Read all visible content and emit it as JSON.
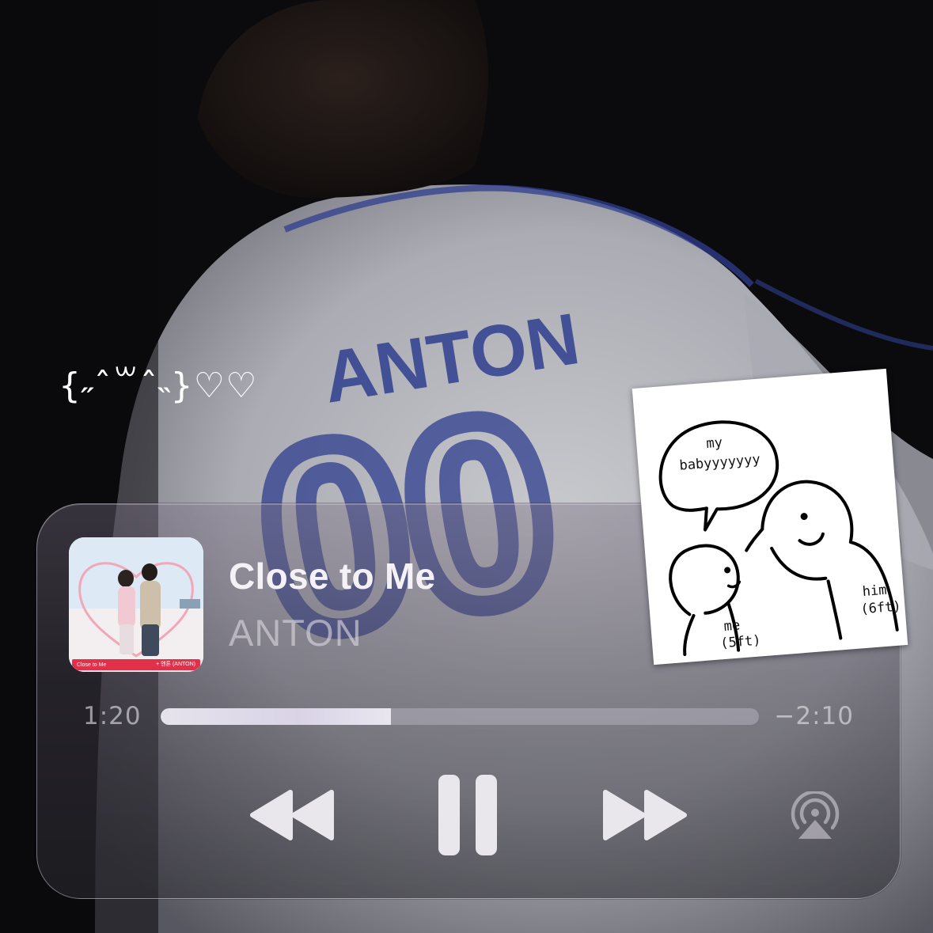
{
  "decoration": {
    "kaomoji": "{˶ˆ꒳ˆ˵}♡♡"
  },
  "background": {
    "jersey_name": "ANTON",
    "jersey_number": "00"
  },
  "now_playing": {
    "album_art": {
      "song_label": "Close to Me",
      "artist_label": "+ 앤톤 (ANTON)"
    },
    "track_title": "Close to Me",
    "artist": "ANTON",
    "elapsed": "1:20",
    "remaining": "−2:10",
    "progress_fraction": 0.385,
    "controls": {
      "rewind_icon": "rewind-icon",
      "pause_icon": "pause-icon",
      "forward_icon": "fast-forward-icon",
      "airplay_icon": "airplay-icon"
    }
  },
  "sticker": {
    "bubble_line1": "my",
    "bubble_line2": "babyyyyyyy",
    "label_me": "me",
    "label_me_height": "(5ft)",
    "label_him": "him",
    "label_him_height": "(6ft)"
  },
  "colors": {
    "widget_tint": "#5a5563",
    "progress_fill": "#e6e3ec",
    "jersey_blue": "#2f3f8f",
    "album_strip": "#e2304b"
  }
}
